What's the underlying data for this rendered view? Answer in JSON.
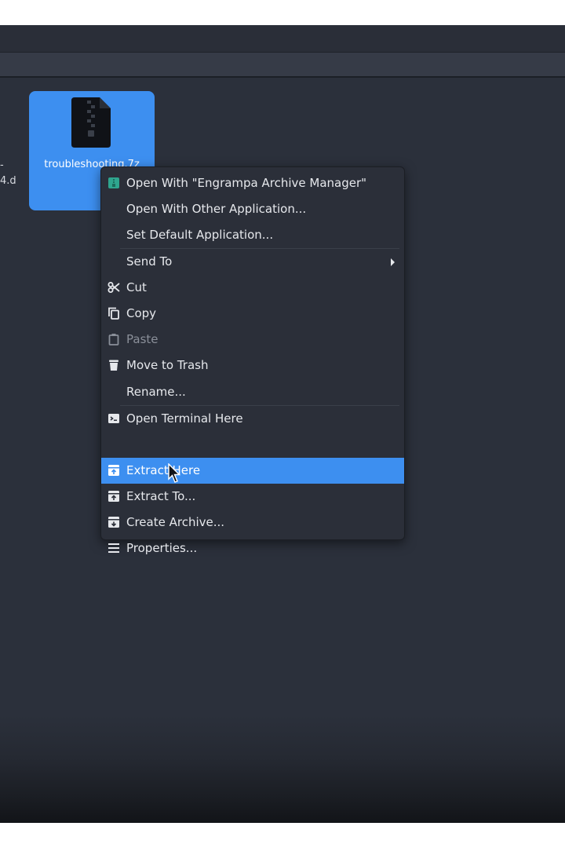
{
  "sidebar_fragment": {
    "line1": "-",
    "line2": "4.d"
  },
  "file": {
    "name": "troubleshooting.7z",
    "icon": "zip-archive-icon"
  },
  "context_menu": {
    "items": [
      {
        "label": "Open With \"Engrampa Archive Manager\"",
        "icon": "engrampa-icon",
        "state": "normal"
      },
      {
        "label": "Open With Other Application...",
        "icon": "",
        "state": "normal"
      },
      {
        "label": "Set Default Application...",
        "icon": "",
        "state": "normal"
      },
      {
        "label": "Send To",
        "icon": "",
        "state": "normal",
        "submenu": true
      },
      {
        "label": "Cut",
        "icon": "scissors-icon",
        "state": "normal"
      },
      {
        "label": "Copy",
        "icon": "copy-icon",
        "state": "normal"
      },
      {
        "label": "Paste",
        "icon": "clipboard-icon",
        "state": "disabled"
      },
      {
        "label": "Move to Trash",
        "icon": "trash-icon",
        "state": "normal"
      },
      {
        "label": "Rename...",
        "icon": "",
        "state": "normal"
      },
      {
        "label": "Open Terminal Here",
        "icon": "terminal-icon",
        "state": "normal"
      },
      {
        "label": "Extract Here",
        "icon": "extract-icon",
        "state": "highlighted"
      },
      {
        "label": "Extract To...",
        "icon": "extract-to-icon",
        "state": "normal"
      },
      {
        "label": "Create Archive...",
        "icon": "create-archive-icon",
        "state": "normal"
      },
      {
        "label": "Properties...",
        "icon": "properties-icon",
        "state": "normal"
      }
    ]
  },
  "colors": {
    "selection": "#3d8ff0",
    "menu_bg": "#2b2f39",
    "view_bg": "#2b303b",
    "text": "#e6e8ec",
    "disabled_text": "#8a8f99"
  }
}
